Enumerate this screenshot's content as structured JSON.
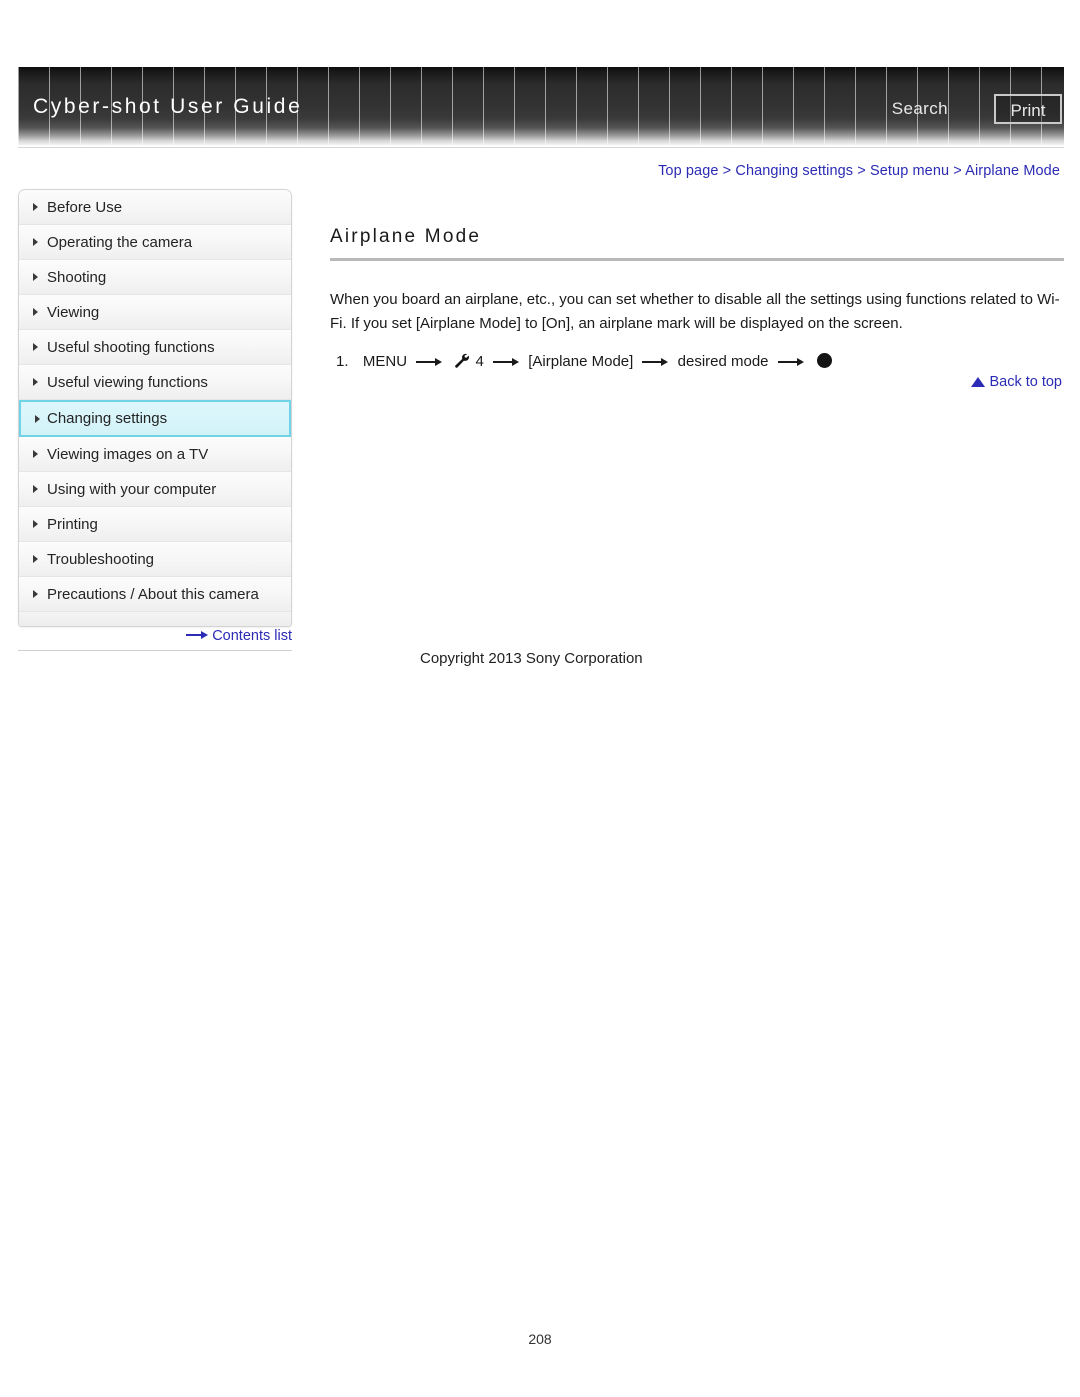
{
  "header": {
    "site_title": "Cyber-shot User Guide",
    "search_label": "Search",
    "print_label": "Print"
  },
  "breadcrumb": {
    "items": [
      "Top page",
      "Changing settings",
      "Setup menu",
      "Airplane Mode"
    ],
    "separator": ">",
    "text": "Top page > Changing settings > Setup menu > Airplane Mode",
    "color": "#2b2bb5"
  },
  "sidebar": {
    "items": [
      {
        "label": "Before Use",
        "active": false
      },
      {
        "label": "Operating the camera",
        "active": false
      },
      {
        "label": "Shooting",
        "active": false
      },
      {
        "label": "Viewing",
        "active": false
      },
      {
        "label": "Useful shooting functions",
        "active": false
      },
      {
        "label": "Useful viewing functions",
        "active": false
      },
      {
        "label": "Changing settings",
        "active": true
      },
      {
        "label": "Viewing images on a TV",
        "active": false
      },
      {
        "label": "Using with your computer",
        "active": false
      },
      {
        "label": "Printing",
        "active": false
      },
      {
        "label": "Troubleshooting",
        "active": false
      },
      {
        "label": "Precautions / About this camera",
        "active": false
      }
    ],
    "contents_list_label": "Contents list",
    "active_highlight_color": "#6fd4e8"
  },
  "main": {
    "title": "Airplane Mode",
    "paragraph": "When you board an airplane, etc., you can set whether to disable all the settings using functions related to Wi-Fi. If you set [Airplane Mode] to [On], an airplane mark will be displayed on the screen.",
    "step": {
      "number": "1.",
      "part1": "MENU",
      "part2": "4",
      "part3": "[Airplane Mode]",
      "part4": "desired mode"
    },
    "back_to_top_label": "Back to top"
  },
  "footer": {
    "copyright": "Copyright 2013 Sony Corporation",
    "page_number": "208"
  }
}
